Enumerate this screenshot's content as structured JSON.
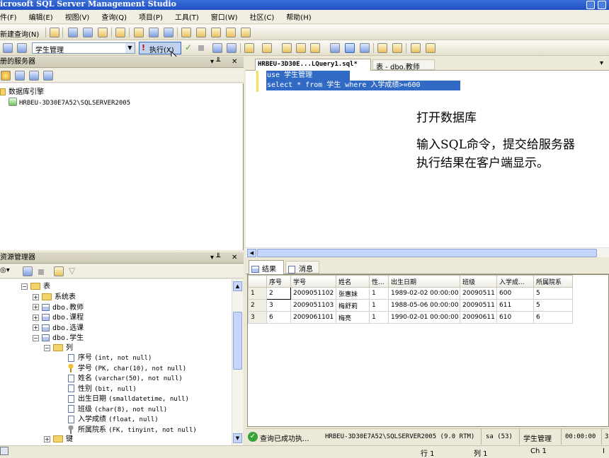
{
  "window": {
    "title": "icrosoft SQL Server Management Studio"
  },
  "menu": [
    "件(F)",
    "编辑(E)",
    "视图(V)",
    "查询(Q)",
    "项目(P)",
    "工具(T)",
    "窗口(W)",
    "社区(C)",
    "帮助(H)"
  ],
  "toolbar1": {
    "new_query": "新建查询(N)"
  },
  "toolbar2": {
    "database": "学生管理",
    "execute": "执行(X)",
    "tooltip": "执行"
  },
  "registered": {
    "title": "册的服务器",
    "root": "数据库引擎",
    "server": "HRBEU-3D30E7A52\\SQLSERVER2005"
  },
  "explorer": {
    "title": "资源管理器",
    "tables_label": "表",
    "items": [
      {
        "text": "系统表",
        "kind": "folder",
        "pm": "+"
      },
      {
        "text": "dbo.教师",
        "kind": "table",
        "pm": "+"
      },
      {
        "text": "dbo.课程",
        "kind": "table",
        "pm": "+"
      },
      {
        "text": "dbo.选课",
        "kind": "table",
        "pm": "+"
      },
      {
        "text": "dbo.学生",
        "kind": "table",
        "pm": "-"
      }
    ],
    "columns_label": "列",
    "columns": [
      {
        "name": "序号",
        "type": "(int, not null)",
        "icon": "col"
      },
      {
        "name": "学号",
        "type": "(PK, char(10), not null)",
        "icon": "key"
      },
      {
        "name": "姓名",
        "type": "(varchar(50), not null)",
        "icon": "col"
      },
      {
        "name": "性别",
        "type": "(bit, null)",
        "icon": "col"
      },
      {
        "name": "出生日期",
        "type": "(smalldatetime, null)",
        "icon": "col"
      },
      {
        "name": "班级",
        "type": "(char(8), not null)",
        "icon": "col"
      },
      {
        "name": "入学成绩",
        "type": "(float, null)",
        "icon": "col"
      },
      {
        "name": "所属院系",
        "type": "(FK, tinyint, not null)",
        "icon": "fk"
      }
    ],
    "keys_label": "键"
  },
  "editor": {
    "tabs": [
      "HRBEU-3D30E...LQuery1.sql*",
      "表 - dbo.教师"
    ],
    "lines": [
      "use 学生管理",
      "select * from 学生 where 入学成绩>=600"
    ]
  },
  "annotations": {
    "line1": "打开数据库",
    "line2": "输入SQL命令，提交给服务器",
    "line3": "执行结果在客户端显示。"
  },
  "results": {
    "tabs": [
      "结果",
      "消息"
    ],
    "headers": [
      "序号",
      "学号",
      "姓名",
      "性...",
      "出生日期",
      "班级",
      "入学成...",
      "所属院系"
    ],
    "rows": [
      [
        "1",
        "2",
        "2009051102",
        "张惠妹",
        "1",
        "1989-02-02 00:00:00",
        "20090511",
        "600",
        "5"
      ],
      [
        "2",
        "3",
        "2009051103",
        "梅舒莉",
        "1",
        "1988-05-06 00:00:00",
        "20090511",
        "611",
        "5"
      ],
      [
        "3",
        "6",
        "2009061101",
        "梅亮",
        "1",
        "1990-02-01 00:00:00",
        "20090611",
        "610",
        "6"
      ]
    ]
  },
  "query_status": {
    "text": "查询已成功执...",
    "server": "HRBEU-3D30E7A52\\SQLSERVER2005 (9.0 RTM)",
    "user": "sa (53)",
    "db": "学生管理",
    "time": "00:00:00",
    "rows": "3"
  },
  "statusbar": {
    "row": "行 1",
    "col": "列 1",
    "ch": "Ch 1",
    "ins": "I"
  }
}
